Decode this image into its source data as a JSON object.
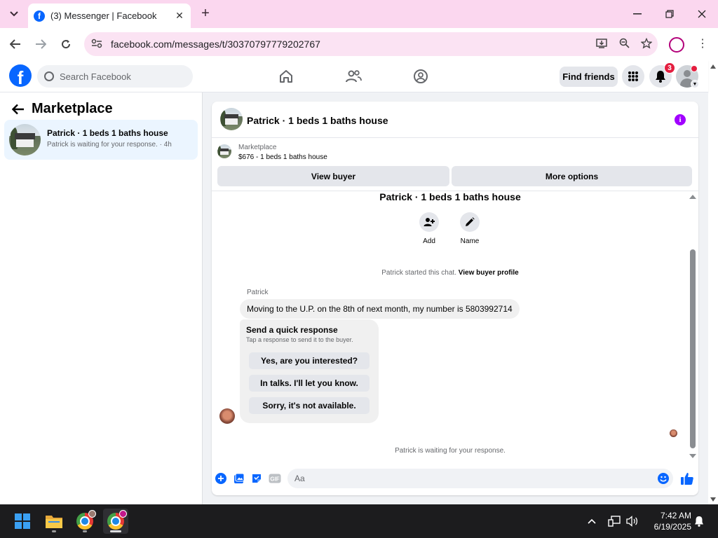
{
  "browser": {
    "tab_title": "(3) Messenger | Facebook",
    "url": "facebook.com/messages/t/30370797779202767"
  },
  "facebook": {
    "search_placeholder": "Search Facebook",
    "find_friends": "Find friends",
    "notification_count": "3"
  },
  "left_panel": {
    "title": "Marketplace",
    "conversation": {
      "name": "Patrick · 1 beds 1 baths house",
      "subtitle": "Patrick is waiting for your response. · 4h"
    }
  },
  "chat": {
    "title": "Patrick · 1 beds 1 baths house",
    "marketplace_label": "Marketplace",
    "listing": "$676 - 1 beds 1 baths house",
    "view_buyer": "View buyer",
    "more_options": "More options",
    "thread_title": "Patrick · 1 beds 1 baths house",
    "actions": [
      {
        "label": "Add"
      },
      {
        "label": "Name"
      }
    ],
    "started_text": "Patrick started this chat.",
    "view_buyer_profile": "View buyer profile",
    "sender": "Patrick",
    "message": "Moving to the U.P. on the 8th of next month, my number is 5803992714",
    "quick_response": {
      "title": "Send a quick response",
      "subtitle": "Tap a response to send it to the buyer.",
      "options": [
        "Yes, are you interested?",
        "In talks. I'll let you know.",
        "Sorry, it's not available."
      ]
    },
    "waiting": "Patrick is waiting for your response.",
    "composer_placeholder": "Aa",
    "gif_label": "GIF"
  },
  "taskbar": {
    "time": "7:42 AM",
    "date": "6/19/2025"
  },
  "colors": {
    "facebook_blue": "#0866ff",
    "tab_bar": "#fbd7ef",
    "info_purple": "#a100ff",
    "notification_red": "#e41e3f"
  }
}
